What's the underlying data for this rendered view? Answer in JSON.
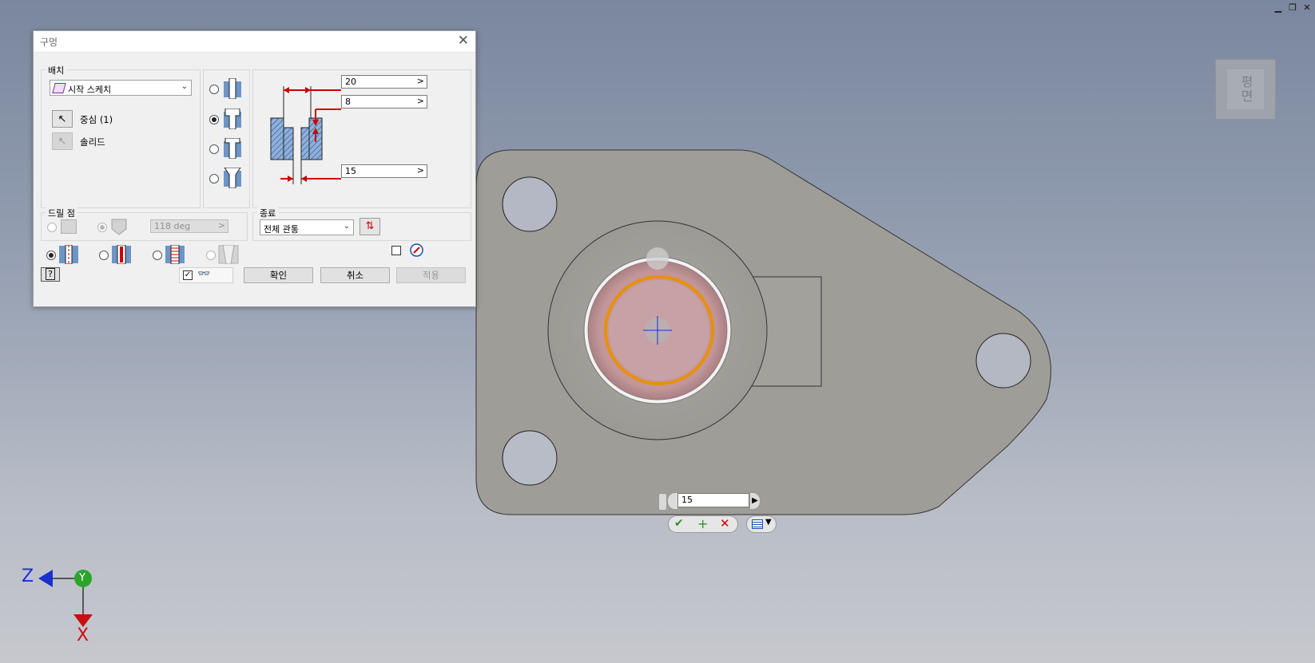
{
  "window_controls": {
    "minimize": "▁",
    "restore": "❐",
    "close": "✕"
  },
  "viewcube": {
    "face_label": "평면"
  },
  "dialog": {
    "title": "구멍",
    "placement": {
      "group_label": "배치",
      "sketch_option": "시작 스케치",
      "center_label": "중심 (1)",
      "solid_label": "솔리드"
    },
    "dimensions": {
      "counterbore_diameter": "20",
      "counterbore_depth": "8",
      "hole_diameter": "15"
    },
    "drill_point": {
      "group_label": "드릴 점",
      "angle": "118 deg"
    },
    "termination": {
      "group_label": "종료",
      "option": "전체 관통"
    },
    "buttons": {
      "ok": "확인",
      "cancel": "취소",
      "apply": "적용"
    },
    "hole_type_selected_index": 1,
    "thread_type_selected_index": 0
  },
  "mini_toolbar": {
    "value": "15"
  },
  "axes": {
    "z": "Z",
    "y": "Y",
    "x": "X"
  },
  "colors": {
    "accent_red": "#cc0000",
    "hole_edge": "#e8900a",
    "face_pink": "#c8a3a8"
  }
}
